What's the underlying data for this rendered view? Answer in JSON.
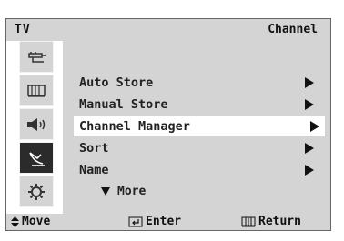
{
  "header": {
    "left": "TV",
    "right": "Channel"
  },
  "sidebar": {
    "icons": [
      "input-plug-icon",
      "picture-icon",
      "sound-icon",
      "channel-antenna-icon",
      "setup-gear-icon"
    ],
    "active": "channel-antenna-icon"
  },
  "menu": {
    "items": [
      {
        "label": "Auto Store"
      },
      {
        "label": "Manual Store"
      },
      {
        "label": "Channel Manager",
        "selected": true
      },
      {
        "label": "Sort"
      },
      {
        "label": "Name"
      }
    ],
    "more": "More"
  },
  "footer": {
    "move": "Move",
    "enter": "Enter",
    "return": "Return"
  },
  "colors": {
    "panel": "#d4d4d4",
    "active_icon_bg": "#2b2b2b",
    "selected_row": "#ffffff"
  }
}
